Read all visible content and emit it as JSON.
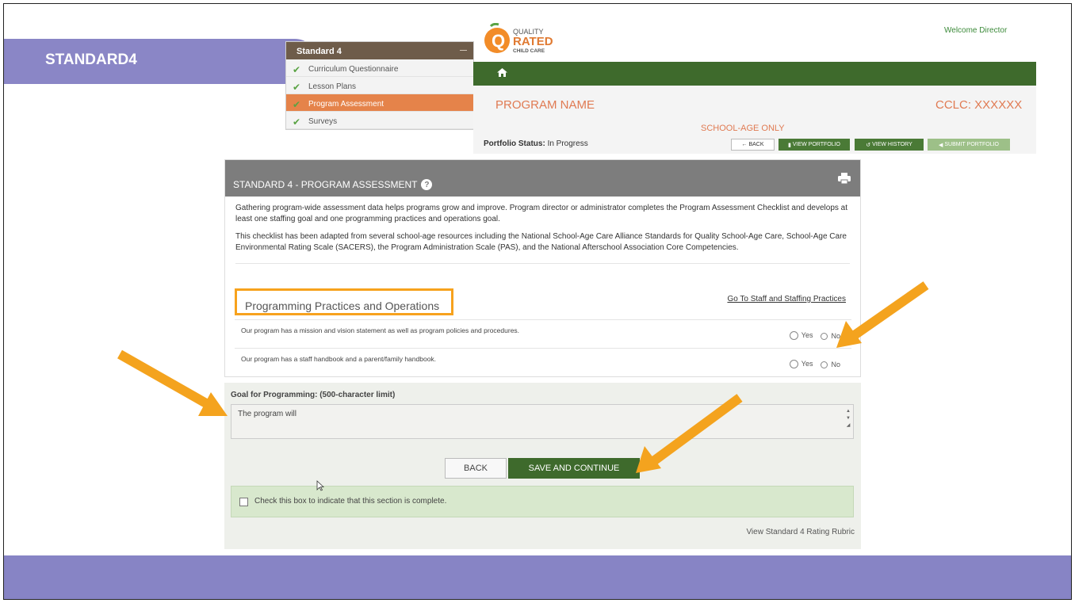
{
  "slide": {
    "title": "STANDARD4"
  },
  "nav": {
    "header": "Standard 4",
    "items": [
      {
        "label": "Curriculum Questionnaire",
        "active": false
      },
      {
        "label": "Lesson Plans",
        "active": false
      },
      {
        "label": "Program Assessment",
        "active": true
      },
      {
        "label": "Surveys",
        "active": false
      }
    ]
  },
  "header": {
    "logo_line1": "QUALITY",
    "logo_line2": "RATED",
    "logo_line3": "CHILD CARE",
    "welcome": "Welcome Director",
    "program_name": "PROGRAM NAME",
    "cclc": "CCLC: XXXXXX",
    "age_group": "SCHOOL-AGE ONLY",
    "status_label": "Portfolio Status:",
    "status_value": "In Progress",
    "buttons": {
      "back": "BACK",
      "view_portfolio": "VIEW PORTFOLIO",
      "view_history": "VIEW HISTORY",
      "submit_portfolio": "SUBMIT PORTFOLIO"
    }
  },
  "panel": {
    "title": "STANDARD 4 - PROGRAM ASSESSMENT",
    "intro_1": "Gathering program-wide assessment data helps programs grow and improve. Program director or administrator completes the Program Assessment Checklist and develops at least one staffing goal and one programming practices and operations goal.",
    "intro_2": "This checklist has been adapted from several school-age resources including the National School-Age Care Alliance Standards for Quality School-Age Care, School-Age Care Environmental Rating Scale (SACERS), the Program Administration Scale (PAS), and the National Afterschool Association Core Competencies.",
    "section_title": "Programming Practices and Operations",
    "goto_link": "Go To Staff and Staffing Practices",
    "questions": [
      {
        "text": "Our program has a mission and vision statement as well as program policies and procedures.",
        "yes": "Yes",
        "no": "No"
      },
      {
        "text": "Our program has a staff handbook and a parent/family handbook.",
        "yes": "Yes",
        "no": "No"
      }
    ]
  },
  "goal": {
    "label": "Goal for Programming: (500-character limit)",
    "value": "The program will"
  },
  "actions": {
    "back": "BACK",
    "save": "SAVE AND CONTINUE",
    "complete_label": "Check this box to indicate that this section is complete.",
    "rubric_link": "View Standard 4 Rating Rubric"
  },
  "colors": {
    "slide_accent": "#8a86c6",
    "brand_green": "#3e6a2c",
    "highlight_orange": "#f7a21d",
    "title_orange": "#e07a52"
  }
}
